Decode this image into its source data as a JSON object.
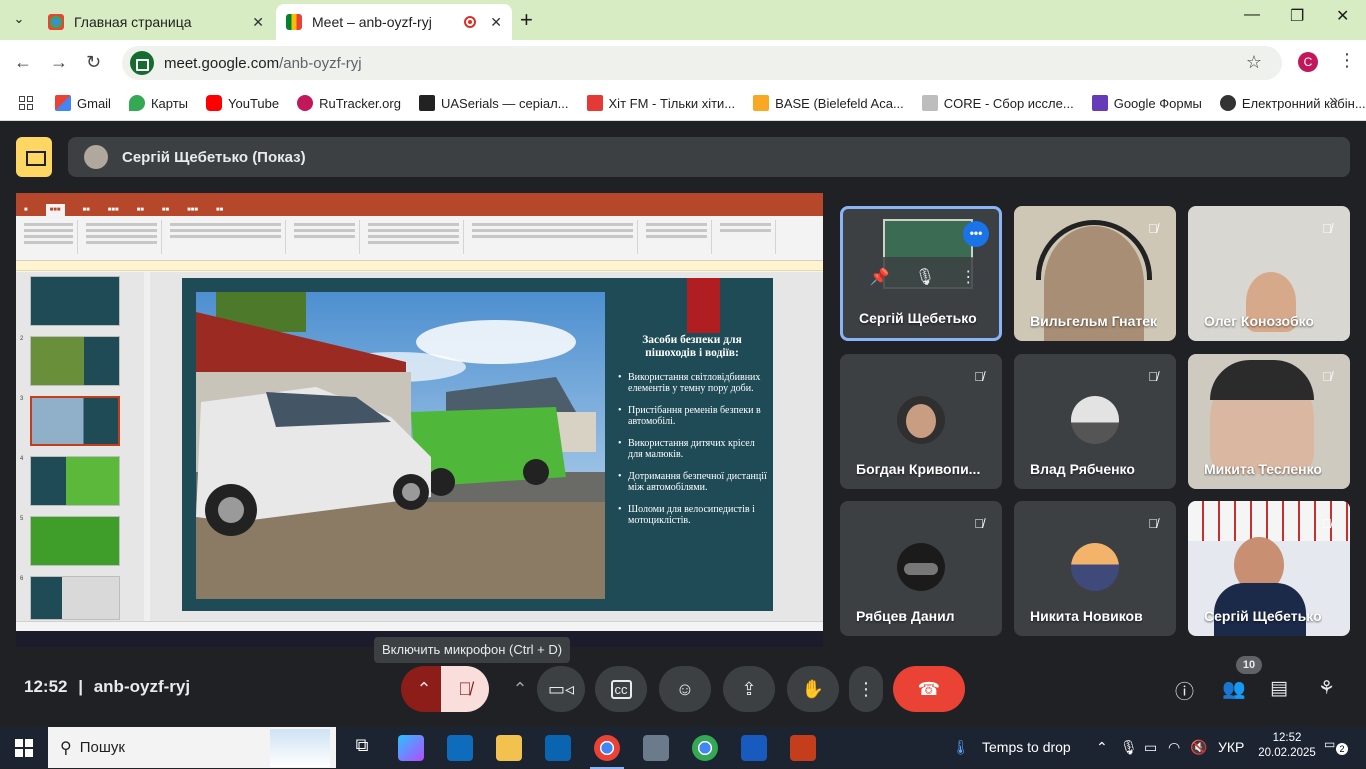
{
  "browser": {
    "tabs": [
      {
        "title": "Главная страница",
        "active": false
      },
      {
        "title": "Meet – anb-oyzf-ryj",
        "active": true
      }
    ],
    "url_host": "meet.google.com",
    "url_path": "/anb-oyzf-ryj",
    "profile_initial": "C",
    "bookmarks": [
      "Gmail",
      "Карты",
      "YouTube",
      "RuTracker.org",
      "UASerials — серіал...",
      "Хіт FM - Тільки хіти...",
      "BASE (Bielefeld Aca...",
      "CORE - Сбор иссле...",
      "Google Формы",
      "Електронний кабін..."
    ]
  },
  "meet": {
    "presenter_label": "Сергій Щебетько (Показ)",
    "slide": {
      "title": "Засоби безпеки для пішоходів і водіїв:",
      "bullets": [
        "Використання світловідбивних елементів у темну пору доби.",
        "Пристібання ременів безпеки в автомобілі.",
        "Використання дитячих крісел для малюків.",
        "Дотримання безпечної дистанції між автомобілями.",
        "Шоломи для велосипедистів і мотоциклістів."
      ]
    },
    "tooltip": "Включить микрофон (Ctrl + D)",
    "participants": [
      {
        "name": "Сергій Щебетько",
        "muted": false
      },
      {
        "name": "Вильгельм Гнатек",
        "muted": true
      },
      {
        "name": "Олег Конозобко",
        "muted": true
      },
      {
        "name": "Богдан Кривопи...",
        "muted": true
      },
      {
        "name": "Влад Рябченко",
        "muted": true
      },
      {
        "name": "Микита Тесленко",
        "muted": true
      },
      {
        "name": "Рябцев Данил",
        "muted": true
      },
      {
        "name": "Никита Новиков",
        "muted": true
      },
      {
        "name": "Сергій Щебетько",
        "muted": true
      }
    ],
    "time": "12:52",
    "meeting_code": "anb-oyzf-ryj",
    "participant_count": "10"
  },
  "taskbar": {
    "search_placeholder": "Пошук",
    "weather": "Temps to drop",
    "language": "УКР",
    "time": "12:52",
    "date": "20.02.2025",
    "notifications": "2"
  },
  "colors": {
    "meet_bg": "#202124",
    "tile_bg": "#3c4043",
    "end_call": "#ea4335",
    "mic_off_bg": "#f9dedc",
    "presenting_yellow": "#fdd663",
    "slide_bg": "#1f4b57",
    "slide_accent": "#b11e22"
  }
}
